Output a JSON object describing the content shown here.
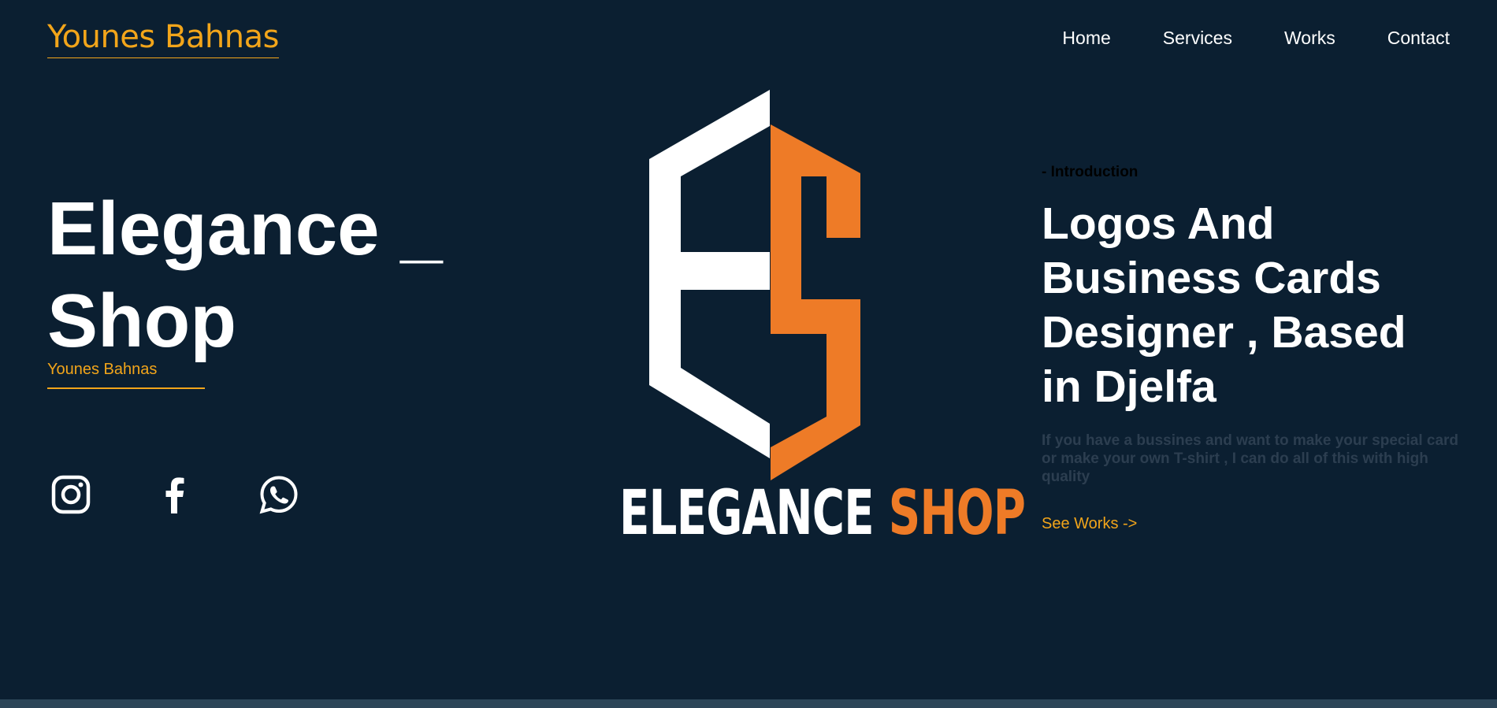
{
  "header": {
    "brand": "Younes Bahnas",
    "nav": [
      "Home",
      "Services",
      "Works",
      "Contact"
    ]
  },
  "hero": {
    "title": "Elegance _ Shop",
    "subname": "Younes Bahnas"
  },
  "socials": [
    {
      "icon": "instagram-icon"
    },
    {
      "icon": "facebook-icon"
    },
    {
      "icon": "whatsapp-icon"
    }
  ],
  "logo": {
    "word1": "ELEGANCE",
    "word2": "SHOP",
    "colors": {
      "white": "#ffffff",
      "orange": "#ee7b27"
    }
  },
  "intro": {
    "label": "- Introduction",
    "headline": "Logos And Business Cards Designer , Based in Djelfa",
    "description": "If you have a bussines and want to make your special card or make your own T-shirt , I can do all of this with high quality",
    "cta": "See Works ->"
  },
  "colors": {
    "background": "#0b1f31",
    "accent": "#f2a51a",
    "muted_text": "#2c3e50",
    "bottom_bar": "#2c4558"
  }
}
